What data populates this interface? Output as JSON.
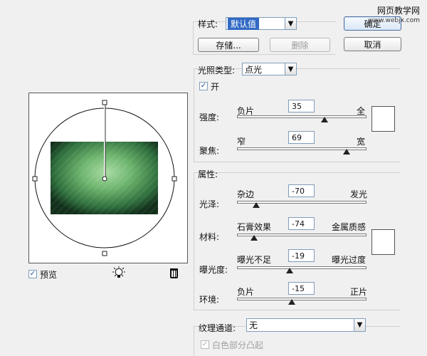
{
  "watermark": {
    "title": "网页教学网",
    "url": "www.webjx.com"
  },
  "style": {
    "label": "样式:",
    "value": "默认值",
    "save_label": "存储...",
    "delete_label": "删除"
  },
  "actions": {
    "ok_label": "确定",
    "cancel_label": "取消"
  },
  "lighting": {
    "type_label": "光照类型:",
    "type_value": "点光",
    "on_label": "开",
    "on_checked": true,
    "intensity": {
      "label": "强度:",
      "left": "负片",
      "right": "全",
      "value": "35",
      "level": 0.675
    },
    "focus": {
      "label": "聚焦:",
      "left": "窄",
      "right": "宽",
      "value": "69",
      "level": 0.845
    }
  },
  "properties": {
    "title": "属性:",
    "gloss": {
      "label": "光泽:",
      "left": "杂边",
      "right": "发光",
      "value": "-70",
      "level": 0.15
    },
    "material": {
      "label": "材料:",
      "left": "石膏效果",
      "right": "金属质感",
      "value": "-74",
      "level": 0.13
    },
    "exposure": {
      "label": "曝光度:",
      "left": "曝光不足",
      "right": "曝光过度",
      "value": "-19",
      "level": 0.405
    },
    "ambience": {
      "label": "环境:",
      "left": "负片",
      "right": "正片",
      "value": "-15",
      "level": 0.425
    }
  },
  "texture": {
    "label": "纹理通道:",
    "value": "无",
    "white_label": "白色部分凸起"
  },
  "preview": {
    "label": "预览",
    "checked": true
  },
  "icons": {
    "preview_check": "checkbox-check-icon",
    "light": "lightbulb-icon",
    "trash": "trash-icon"
  },
  "colors": {
    "background": "#f0f0f0",
    "selection": "#316ac5",
    "preview_green": "#58a55d"
  }
}
